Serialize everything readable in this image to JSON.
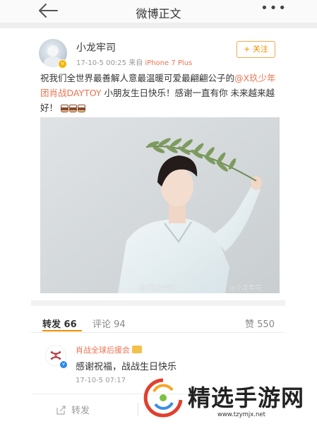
{
  "nav": {
    "back_icon": "arrow-left-icon",
    "title": "微博正文",
    "more_icon": "more-dots-icon",
    "more_glyph": "•••"
  },
  "post": {
    "user_name": "小龙牢司",
    "verified_icon": "verified-v-badge",
    "time": "17-10-5 00:25",
    "source_prefix": "来自",
    "source": "iPhone 7 Plus",
    "follow_label": "+ 关注",
    "text_part1": "祝我们全世界最善解人意最温暖可爱最翩翩公子的",
    "mention": "@X玖少年团肖战DAYTOY",
    "text_part2": " 小朋友生日快乐！感谢一直有你 未来越来越好！",
    "cake_icon": "cake-emoji-icon",
    "photo_watermark_left": "@X玖少年团",
    "photo_watermark_right": "@小龙牢司"
  },
  "tabs": [
    {
      "label": "转发",
      "count": "66",
      "active": true
    },
    {
      "label": "评论",
      "count": "94",
      "active": false
    },
    {
      "label": "赞",
      "count": "550",
      "active": false
    }
  ],
  "comment": {
    "user_name": "肖战全球后援会",
    "text": "感谢祝福，战战生日快乐",
    "time": "17-10-5 07:17"
  },
  "toolbar": {
    "share_label": "转发",
    "share_icon": "share-icon"
  },
  "watermark": {
    "brand": "精选手游网",
    "url": "www.tzymjx.net"
  },
  "colors": {
    "accent_orange": "#f08f00",
    "link_color": "#eb7350",
    "verified_yellow": "#f7b500",
    "verified_blue": "#2a88e8"
  }
}
